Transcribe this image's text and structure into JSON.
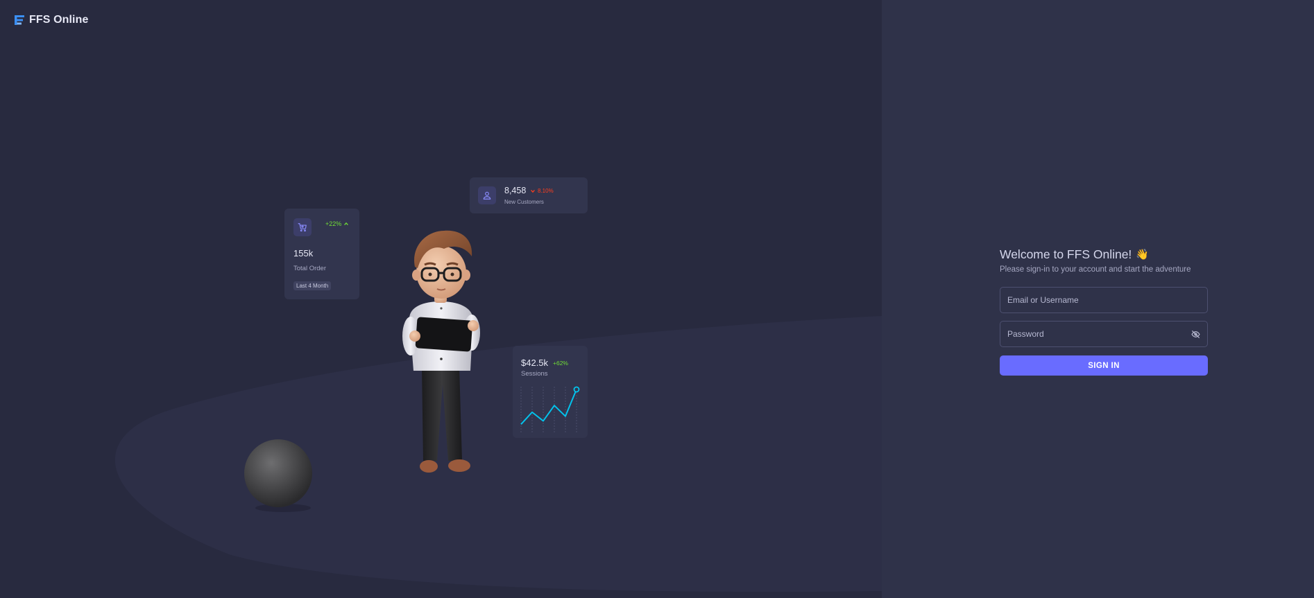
{
  "brand": {
    "name": "FFS Online",
    "logo_icon": "ffs-logo-icon",
    "logo_color": "#3b8ff3"
  },
  "illustration": {
    "order_card": {
      "icon": "shopping-cart-icon",
      "trend": "+22%",
      "trend_icon": "chevron-up-icon",
      "value": "155k",
      "label": "Total Order",
      "chip": "Last 4 Month"
    },
    "customers_card": {
      "icon": "user-icon",
      "value": "8,458",
      "trend_icon": "chevron-down-icon",
      "trend": "8.10%",
      "label": "New Customers"
    },
    "sessions_card": {
      "value": "$42.5k",
      "trend": "+62%",
      "label": "Sessions",
      "sparkline": [
        8,
        26,
        13,
        36,
        20,
        60
      ]
    },
    "character_image": "3d-man-with-tablet",
    "ball_image": "dark-sphere"
  },
  "login": {
    "title": "Welcome to FFS Online!",
    "title_emoji": "👋",
    "subtitle": "Please sign-in to your account and start the adventure",
    "email_placeholder": "Email or Username",
    "email_value": "",
    "password_placeholder": "Password",
    "password_value": "",
    "password_toggle_icon": "eye-off-icon",
    "signin_label": "SIGN IN"
  },
  "colors": {
    "left_background": "#282a3f",
    "right_background": "#2f3249",
    "card_background": "#32354e",
    "primary": "#696cff",
    "success": "#71dd37",
    "danger": "#ff3e1d",
    "sparkline": "#03c3ec"
  }
}
